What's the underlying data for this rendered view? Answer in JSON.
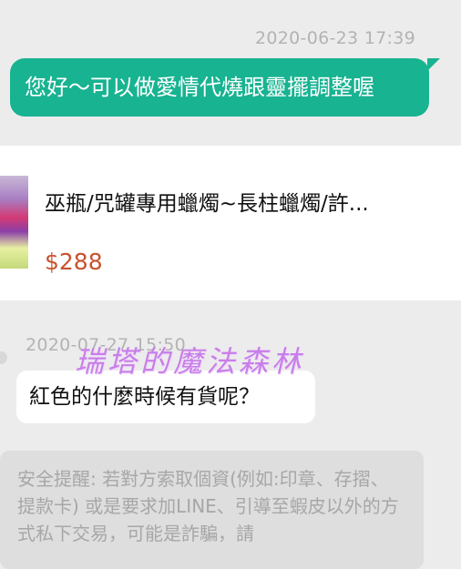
{
  "chat": {
    "timestamp_out": "2020-06-23 17:39",
    "outgoing_message": "您好～可以做愛情代燒跟靈擺調整喔",
    "product": {
      "title": "巫瓶/咒罐專用蠟燭~長柱蠟燭/許...",
      "price": "$288"
    },
    "timestamp_in": "2020-07-27 15:50",
    "incoming_message": "紅色的什麼時候有貨呢？",
    "watermark": "瑞塔的魔法森林",
    "safety_notice": "安全提醒: 若對方索取個資(例如:印章、存摺、提款卡) 或是要求加LINE、引導至蝦皮以外的方式私下交易，可能是詐騙，請"
  },
  "colors": {
    "outgoing_bubble": "#18b391",
    "price": "#c7532e",
    "watermark": "#c87ee8",
    "warning_icon": "#f4b400"
  },
  "icons": {
    "warning": "warning-icon"
  }
}
